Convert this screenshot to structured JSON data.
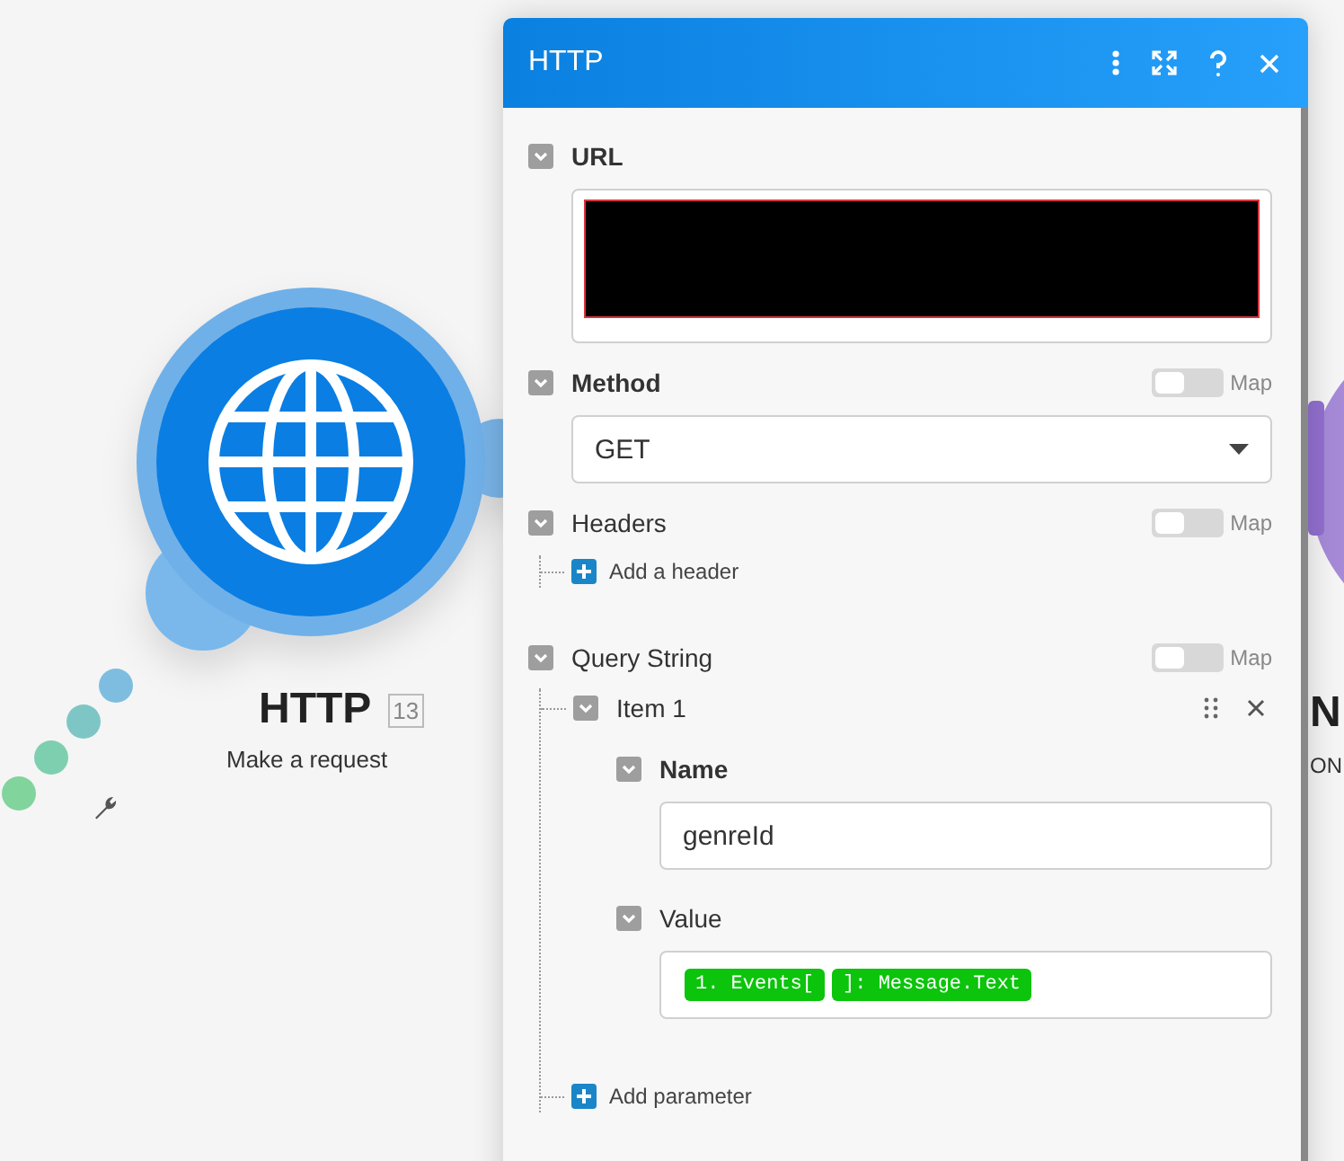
{
  "canvas": {
    "module": {
      "title": "HTTP",
      "badge": "13",
      "subtitle": "Make a request"
    },
    "next_module": {
      "title": "N",
      "subtitle": "ON"
    }
  },
  "window": {
    "title": "HTTP"
  },
  "fields": [
    {
      "kind": "url",
      "label": "URL",
      "bold": true
    },
    {
      "kind": "select",
      "label": "Method",
      "bold": true,
      "map_on": false,
      "map_label": "Map",
      "value": "GET"
    },
    {
      "kind": "list",
      "label": "Headers",
      "bold": false,
      "map_on": false,
      "map_label": "Map",
      "add_label": "Add a header"
    },
    {
      "kind": "query",
      "label": "Query String",
      "bold": false,
      "map_on": false,
      "map_label": "Map",
      "add_label": "Add parameter",
      "items": [
        {
          "label": "Item 1",
          "name_label": "Name",
          "name_value": "genreId",
          "value_label": "Value",
          "value_tokens": [
            "1. Events[",
            "]: Message.Text"
          ]
        }
      ]
    }
  ]
}
